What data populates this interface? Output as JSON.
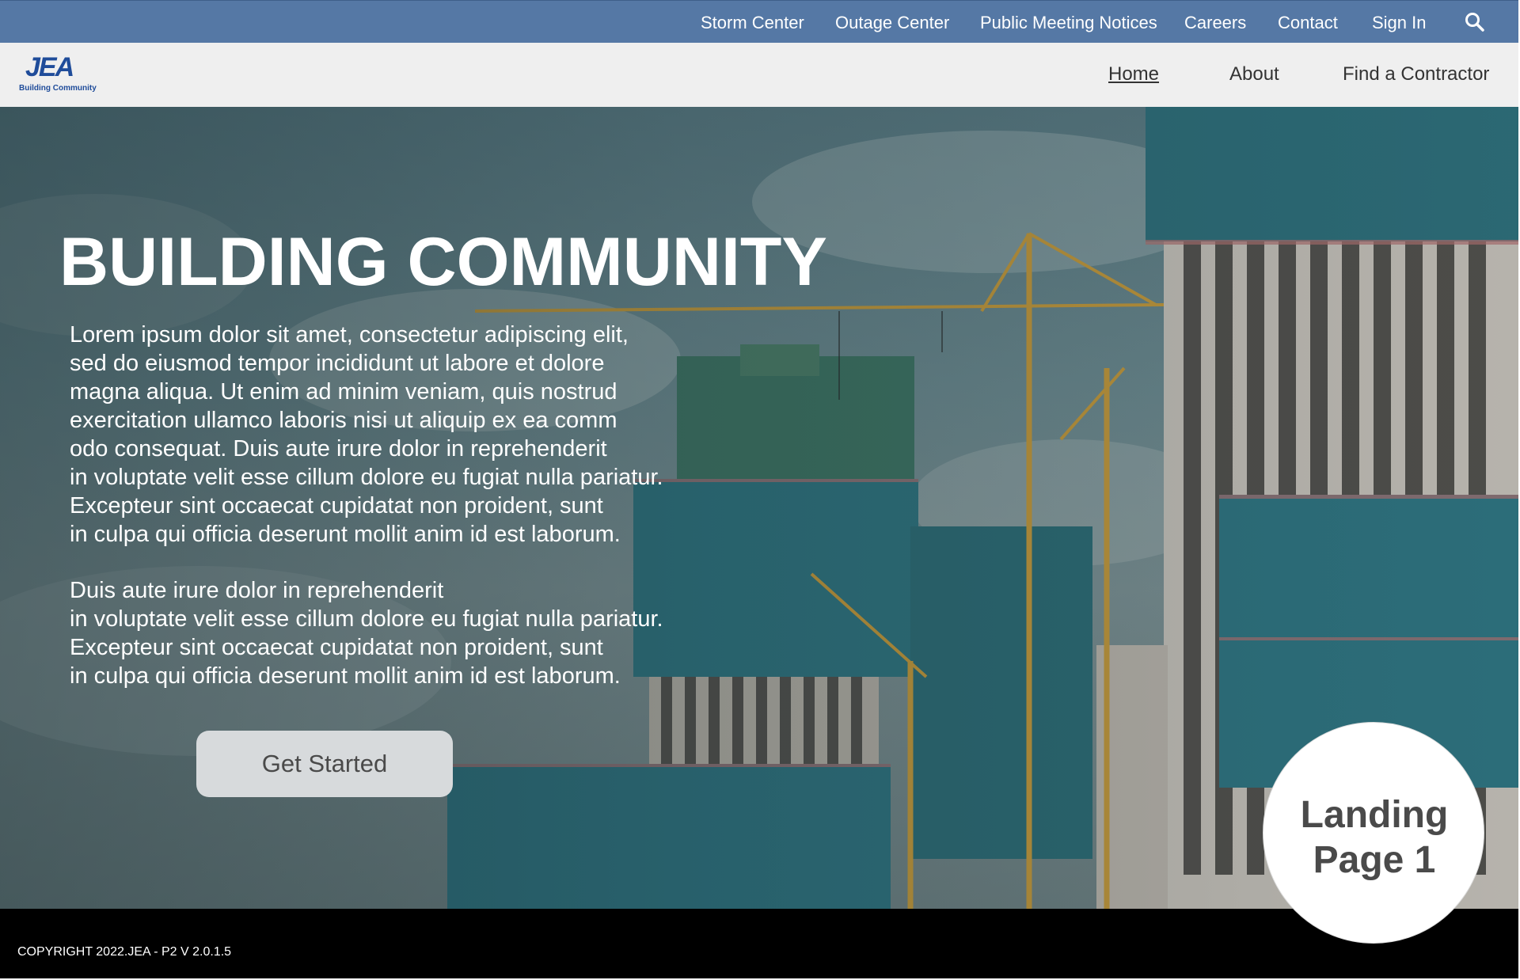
{
  "utility_nav": {
    "items": [
      {
        "label": "Storm Center"
      },
      {
        "label": "Outage Center"
      },
      {
        "label": "Public Meeting Notices"
      },
      {
        "label": "Careers"
      },
      {
        "label": "Contact"
      },
      {
        "label": "Sign In"
      }
    ],
    "search_icon": "search-icon",
    "background_color": "#5578a5"
  },
  "logo": {
    "mark": "JEA",
    "tagline": "Building Community",
    "color": "#1f4c9a"
  },
  "main_nav": {
    "items": [
      {
        "label": "Home",
        "active": true
      },
      {
        "label": "About",
        "active": false
      },
      {
        "label": "Find a Contractor",
        "active": false
      }
    ]
  },
  "hero": {
    "title": "BUILDING COMMUNITY",
    "paragraph_1": "Lorem ipsum dolor sit amet, consectetur adipiscing elit,\nsed do eiusmod tempor incididunt ut labore et dolore\nmagna aliqua. Ut enim ad minim veniam, quis nostrud\nexercitation ullamco laboris nisi ut aliquip ex ea comm\nodo consequat. Duis aute irure dolor in reprehenderit\nin voluptate velit esse cillum dolore eu fugiat nulla pariatur.\nExcepteur sint occaecat cupidatat non proident, sunt\nin culpa qui officia deserunt mollit anim id est laborum.",
    "paragraph_2": "Duis aute irure dolor in reprehenderit\nin voluptate velit esse cillum dolore eu fugiat nulla pariatur.\nExcepteur sint occaecat cupidatat non proident, sunt\nin culpa qui officia deserunt mollit anim id est laborum.",
    "cta_label": "Get Started"
  },
  "footer": {
    "copyright": "COPYRIGHT 2022.JEA - P2 V 2.0.1.5"
  },
  "page_badge": {
    "label": "Landing\nPage 1"
  }
}
